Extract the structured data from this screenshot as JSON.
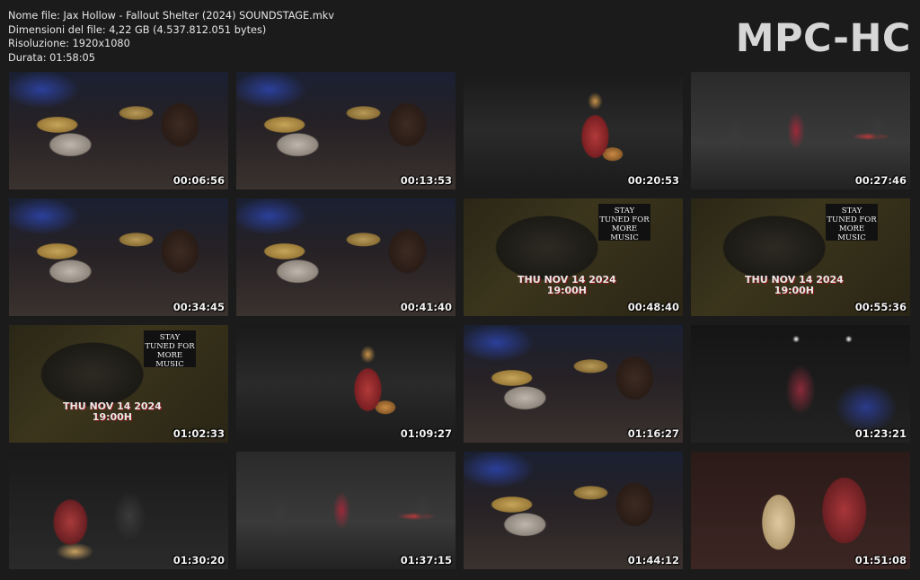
{
  "info": {
    "line1": "Nome file: Jax Hollow - Fallout Shelter (2024) SOUNDSTAGE.mkv",
    "line2": "Dimensioni del file: 4,22 GB (4.537.812.051 bytes)",
    "line3": "Risoluzione: 1920x1080",
    "line4": "Durata: 01:58:05"
  },
  "logo": "MPC-HC",
  "overlay": {
    "stay": "STAY TUNED FOR MORE MUSIC",
    "date": "THU NOV 14 2024",
    "time": "19:00H"
  },
  "thumbnails": [
    {
      "time": "00:06:56",
      "scene": "drums"
    },
    {
      "time": "00:13:53",
      "scene": "drums"
    },
    {
      "time": "00:20:53",
      "scene": "singer"
    },
    {
      "time": "00:27:46",
      "scene": "band"
    },
    {
      "time": "00:34:45",
      "scene": "drums"
    },
    {
      "time": "00:41:40",
      "scene": "drums"
    },
    {
      "time": "00:48:40",
      "scene": "screen"
    },
    {
      "time": "00:55:36",
      "scene": "screen"
    },
    {
      "time": "01:02:33",
      "scene": "screen"
    },
    {
      "time": "01:09:27",
      "scene": "singer"
    },
    {
      "time": "01:16:27",
      "scene": "drums"
    },
    {
      "time": "01:23:21",
      "scene": "spot"
    },
    {
      "time": "01:30:20",
      "scene": "duet"
    },
    {
      "time": "01:37:15",
      "scene": "band"
    },
    {
      "time": "01:44:12",
      "scene": "drums"
    },
    {
      "time": "01:51:08",
      "scene": "closeup"
    }
  ]
}
